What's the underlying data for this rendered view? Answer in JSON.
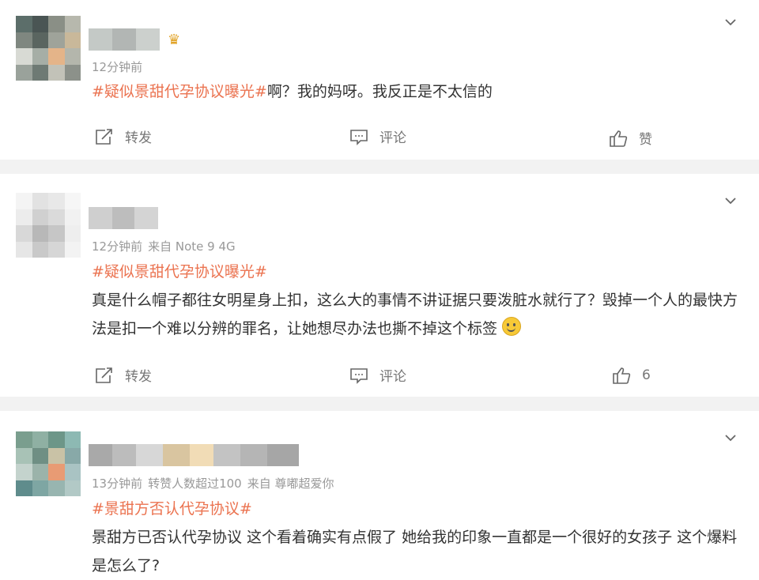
{
  "comments": [
    {
      "time": "12分钟前",
      "source": "",
      "extra": "",
      "hashtag": "#疑似景甜代孕协议曝光#",
      "text": "啊？我的妈呀。我反正是不太信的",
      "actions": {
        "repost": "转发",
        "comment": "评论",
        "like": "赞"
      }
    },
    {
      "time": "12分钟前",
      "source": "来自 Note 9 4G",
      "extra": "",
      "hashtag": "#疑似景甜代孕协议曝光#",
      "text": "真是什么帽子都往女明星身上扣，这么大的事情不讲证据只要泼脏水就行了？毁掉一个人的最快方法是扣一个难以分辨的罪名，让她想尽办法也撕不掉这个标签",
      "actions": {
        "repost": "转发",
        "comment": "评论",
        "like": "6"
      }
    },
    {
      "time": "13分钟前",
      "source": "来自 尊嘟超爱你",
      "extra": "转赞人数超过100",
      "hashtag": "#景甜方否认代孕协议#",
      "text": "景甜方已否认代孕协议 这个看着确实有点假了 她给我的印象一直都是一个很好的女孩子 这个爆料是怎么了?",
      "actions": {
        "repost": "",
        "comment": "",
        "like": ""
      }
    }
  ],
  "icons": {
    "chevron": "chevron-down-icon",
    "repost": "repost-icon",
    "comment": "comment-icon",
    "like": "thumbs-up-icon",
    "crown": "crown-badge-icon",
    "emoji": "smile-emoji-icon"
  },
  "colors": {
    "hashtag": "#eb7350",
    "meta": "#999999",
    "separator": "#f2f2f2"
  }
}
